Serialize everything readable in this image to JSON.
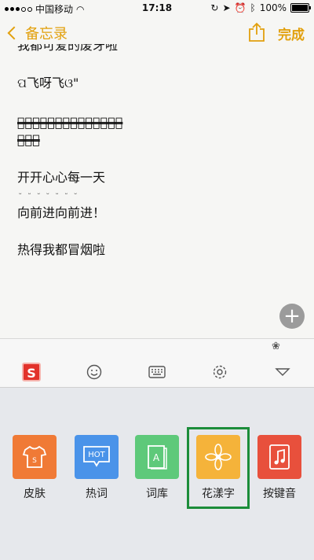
{
  "status_bar": {
    "carrier": "中国移动",
    "time": "17:18",
    "battery_text": "100%",
    "battery_level": 1.0
  },
  "nav": {
    "back_label": "备忘录",
    "done_label": "完成"
  },
  "note": {
    "lines": [
      "我都可爱的废牙啦",
      "ପ飞呀飞ଓ\"",
      "今̶天̶风̶真̶的̶好̶大̶啊̶，̶把̶雾̶霾̶都̶吹̶",
      "走̶啦̶～̶",
      "开开心心每一天",
      "向前进向前进！",
      "热得我都冒烟啦"
    ]
  },
  "toolbar": {
    "icons": [
      "sogou-logo-icon",
      "emoji-icon",
      "keyboard-icon",
      "settings-icon",
      "collapse-icon"
    ]
  },
  "panel": {
    "items": [
      {
        "label": "皮肤",
        "icon": "skin-icon",
        "color": "#f07a36"
      },
      {
        "label": "热词",
        "icon": "hot-icon",
        "color": "#4a93e9"
      },
      {
        "label": "词库",
        "icon": "dictionary-icon",
        "color": "#5ec97a"
      },
      {
        "label": "花漾字",
        "icon": "flower-text-icon",
        "color": "#f5b33a"
      },
      {
        "label": "按键音",
        "icon": "key-sound-icon",
        "color": "#e8503c"
      }
    ]
  }
}
